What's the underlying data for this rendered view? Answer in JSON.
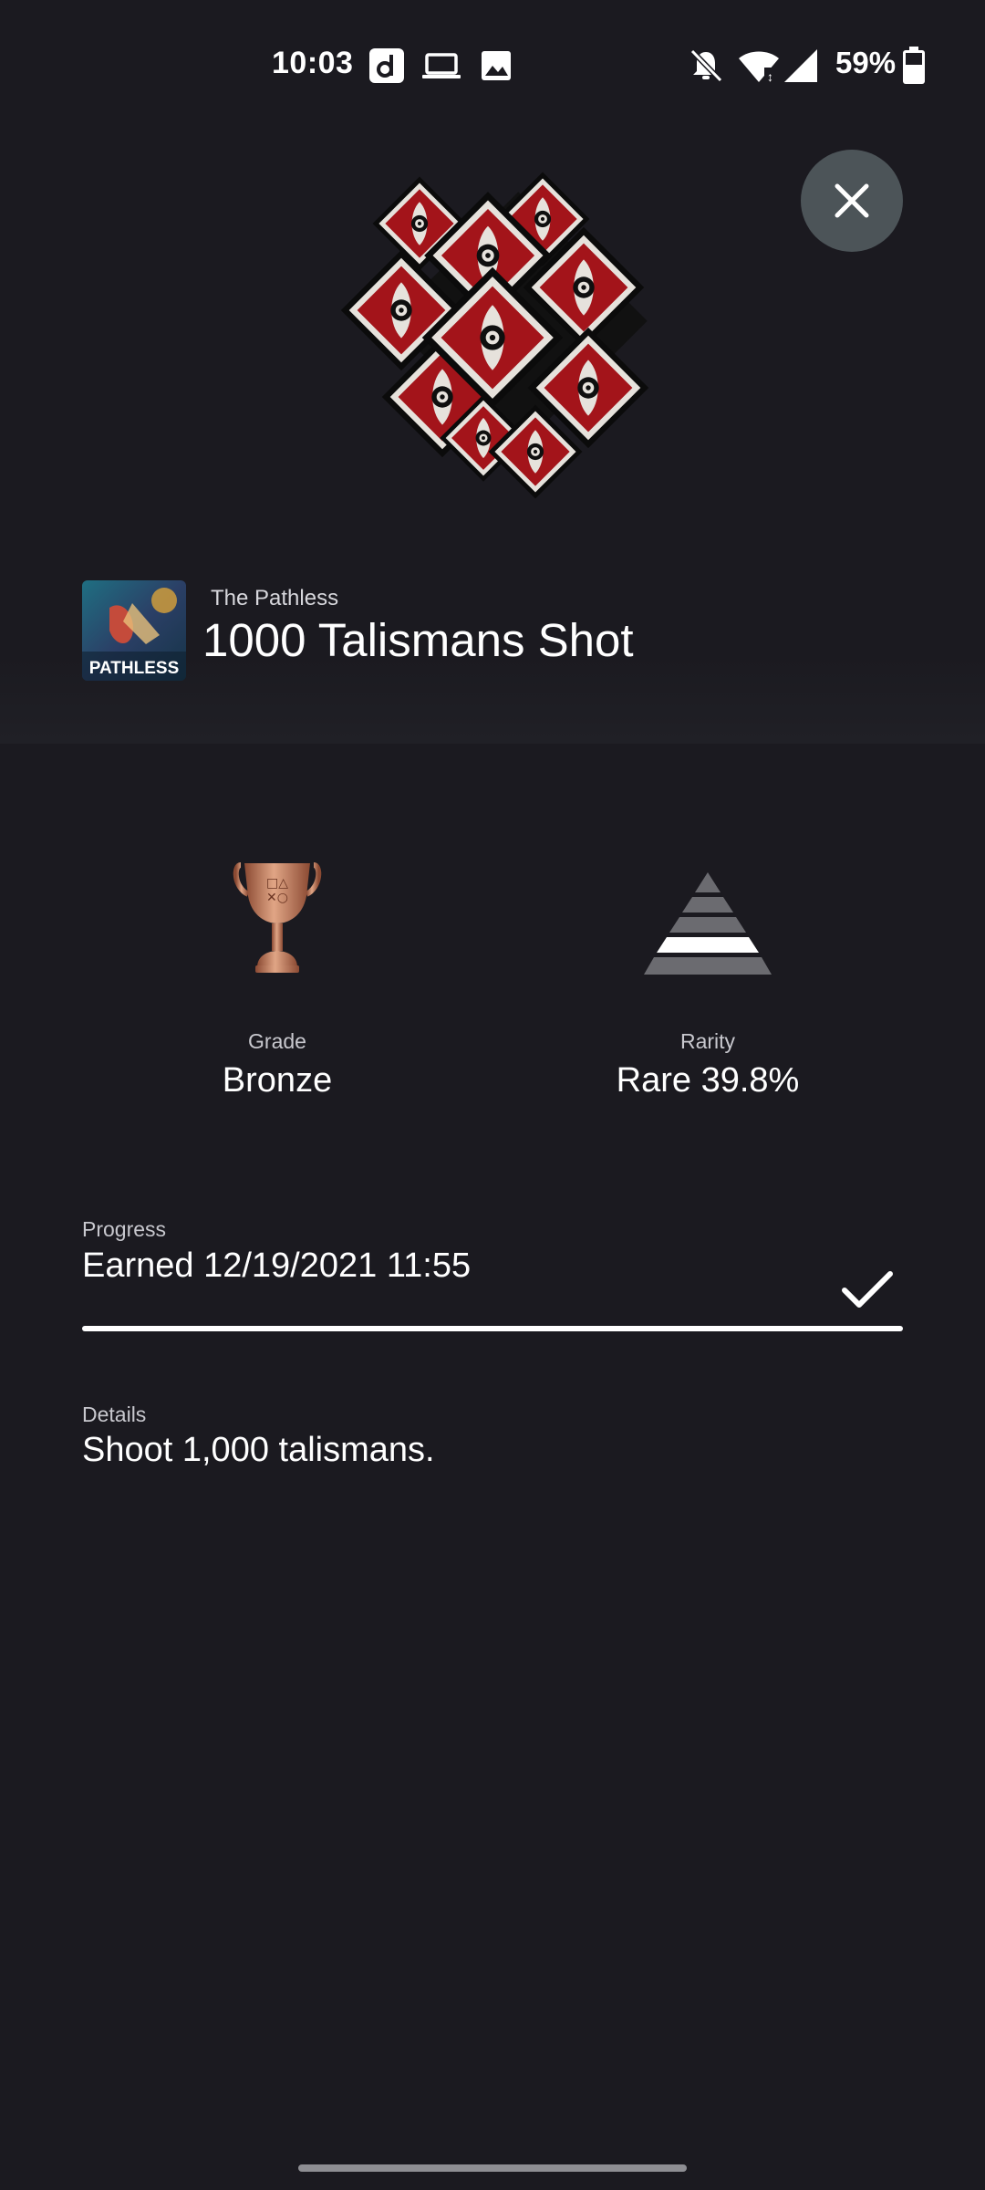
{
  "status_bar": {
    "time": "10:03",
    "battery": "59%",
    "left_icons": [
      "app-d-icon",
      "laptop-icon",
      "image-icon"
    ],
    "right_icons": [
      "bell-muted-icon",
      "wifi-icon",
      "signal-icon",
      "battery-icon"
    ]
  },
  "game": {
    "name": "The Pathless",
    "thumb_text": "PATHLESS"
  },
  "trophy": {
    "title": "1000 Talismans Shot"
  },
  "stats": {
    "grade_label": "Grade",
    "grade_value": "Bronze",
    "rarity_label": "Rarity",
    "rarity_value": "Rare 39.8%"
  },
  "progress": {
    "label": "Progress",
    "text": "Earned 12/19/2021  11:55",
    "fraction": 1.0
  },
  "details": {
    "label": "Details",
    "text": "Shoot 1,000 talismans."
  },
  "colors": {
    "background": "#1b1a20",
    "bronze": "#c98b6a",
    "talisman_red": "#a3141a",
    "close_bg": "#4c5458"
  }
}
